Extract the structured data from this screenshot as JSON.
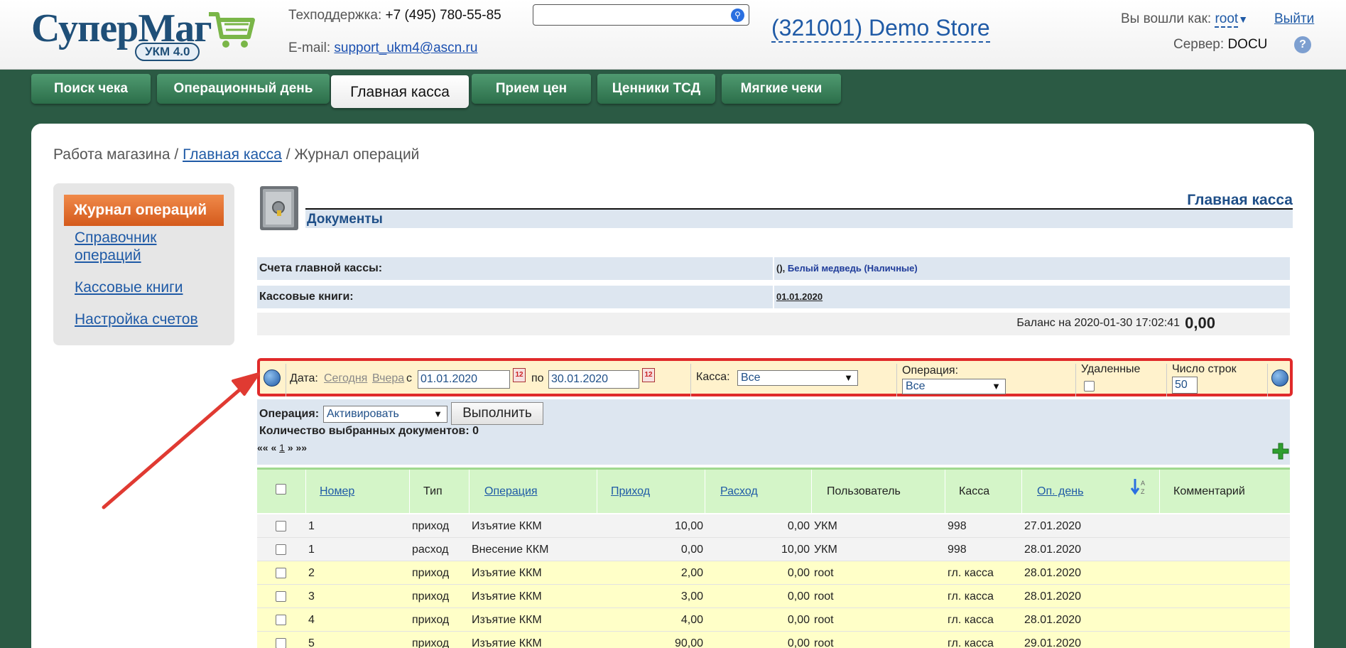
{
  "header": {
    "logo_text": "СуперМаг",
    "logo_badge": "УКМ 4.0",
    "support_label": "Техподдержка:",
    "support_phone": "+7 (495) 780-55-85",
    "email_label": "E-mail:",
    "email": "support_ukm4@ascn.ru",
    "search_value": "",
    "store": "(321001) Demo Store",
    "login_label": "Вы вошли как:",
    "user": "root",
    "logout": "Выйти",
    "server_label": "Сервер:",
    "server": "DOCU",
    "help": "?"
  },
  "tabs": [
    "Поиск чека",
    "Операционный день",
    "Главная касса",
    "Прием цен",
    "Ценники ТСД",
    "Мягкие чеки"
  ],
  "breadcrumb": {
    "root": "Работа магазина",
    "sep1": "/",
    "link": "Главная касса",
    "sep2": "/",
    "current": "Журнал операций"
  },
  "leftnav": {
    "active": "Журнал операций",
    "items": [
      "Справочник операций",
      "Кассовые книги",
      "Настройка счетов"
    ],
    "item0_line1": "Справочник",
    "item0_line2": "операций"
  },
  "main": {
    "section_title": "Главная касса",
    "docs_title": "Документы",
    "accounts_label": "Счета главной кассы:",
    "accounts_prefix": "(),",
    "accounts_value": "Белый медведь (Наличные)",
    "books_label": "Кассовые книги:",
    "books_value": "01.01.2020",
    "balance_label": "Баланс на 2020-01-30 17:02:41",
    "balance_value": "0,00"
  },
  "filter": {
    "date_label": "Дата:",
    "today": "Сегодня",
    "yesterday": "Вчера",
    "from_label": "с",
    "from_value": "01.01.2020",
    "to_label": "по",
    "to_value": "30.01.2020",
    "kassa_label": "Касса:",
    "kassa_value": "Все",
    "operation_label": "Операция:",
    "operation_value": "Все",
    "deleted_label": "Удаленные",
    "rows_label": "Число строк",
    "rows_value": "50",
    "cal_glyph": "12"
  },
  "opbar": {
    "label": "Операция:",
    "select_value": "Активировать",
    "execute": "Выполнить",
    "count_label": "Количество выбранных документов: 0",
    "pager_prev": "«« «",
    "pager_page": "1",
    "pager_next": "» »»"
  },
  "table": {
    "headers": [
      "Номер",
      "Тип",
      "Операция",
      "Приход",
      "Расход",
      "Пользователь",
      "Касса",
      "Оп. день",
      "Комментарий"
    ],
    "rows": [
      {
        "num": "1",
        "type": "приход",
        "op": "Изъятие ККМ",
        "in": "10,00",
        "out": "0,00",
        "user": "УКМ",
        "kassa": "998",
        "day": "27.01.2020",
        "comment": "",
        "style": "grey"
      },
      {
        "num": "1",
        "type": "расход",
        "op": "Внесение ККМ",
        "in": "0,00",
        "out": "10,00",
        "user": "УКМ",
        "kassa": "998",
        "day": "28.01.2020",
        "comment": "",
        "style": "grey"
      },
      {
        "num": "2",
        "type": "приход",
        "op": "Изъятие ККМ",
        "in": "2,00",
        "out": "0,00",
        "user": "root",
        "kassa": "гл. касса",
        "day": "28.01.2020",
        "comment": "",
        "style": "yellow"
      },
      {
        "num": "3",
        "type": "приход",
        "op": "Изъятие ККМ",
        "in": "3,00",
        "out": "0,00",
        "user": "root",
        "kassa": "гл. касса",
        "day": "28.01.2020",
        "comment": "",
        "style": "yellow"
      },
      {
        "num": "4",
        "type": "приход",
        "op": "Изъятие ККМ",
        "in": "4,00",
        "out": "0,00",
        "user": "root",
        "kassa": "гл. касса",
        "day": "28.01.2020",
        "comment": "",
        "style": "yellow"
      },
      {
        "num": "5",
        "type": "приход",
        "op": "Изъятие ККМ",
        "in": "90,00",
        "out": "0,00",
        "user": "root",
        "kassa": "гл. касса",
        "day": "29.01.2020",
        "comment": "",
        "style": "yellow"
      }
    ]
  },
  "colors": {
    "background": "#2b5a44",
    "tab": "#3d8a5e",
    "active_nav": "#e0702f",
    "highlight": "#e02a2a",
    "link": "#1f5aa6"
  }
}
